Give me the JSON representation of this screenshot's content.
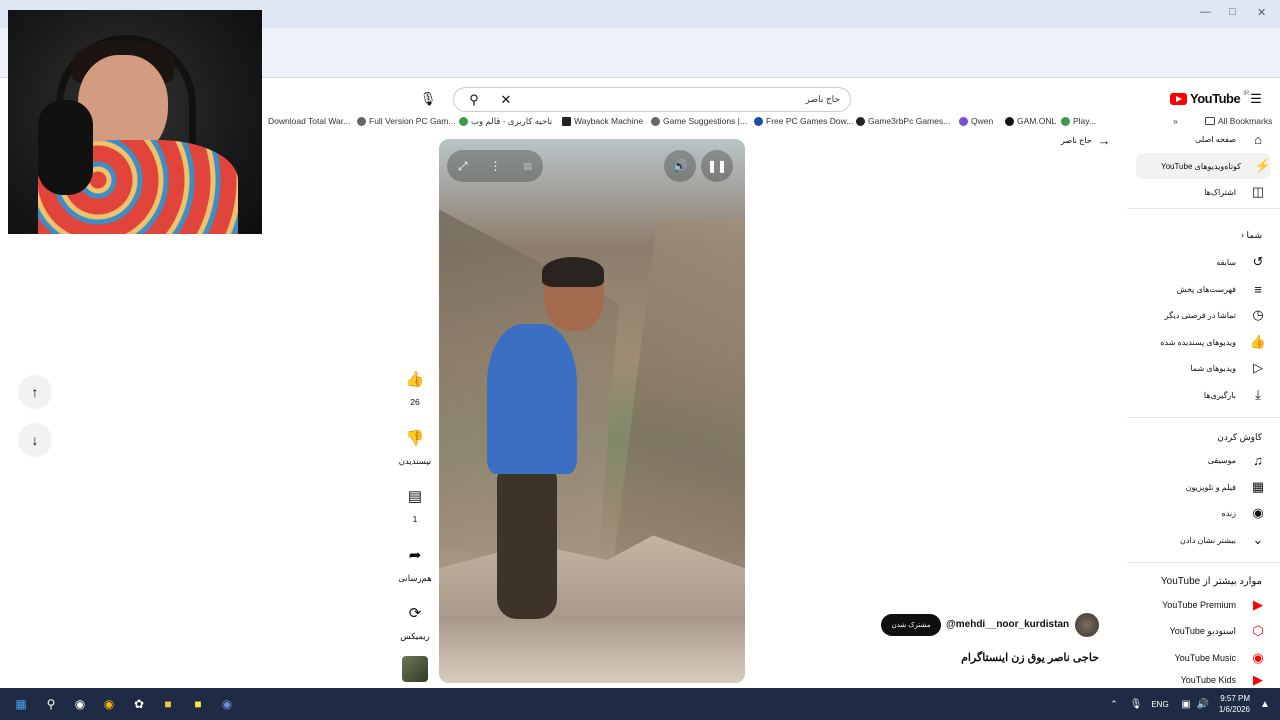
{
  "browser": {
    "bookmarks": [
      "Download Total War...",
      "Full Version PC Gam...",
      "ناحیه کاربری - قالم وب",
      "Wayback Machine",
      "Game Suggestions |...",
      "Free PC Games Dow...",
      "Game3rbPc Games...",
      "Qwen",
      "GAM.ONL",
      "Play..."
    ],
    "all_bookmarks": "All Bookmarks"
  },
  "youtube": {
    "logo_text": "YouTube",
    "logo_cc": "IR",
    "search": {
      "query": "حاج ناصر"
    },
    "back_label": "حاج ناصر",
    "sidebar": {
      "main": [
        {
          "label": "صفحه اصلی",
          "icon": "home-icon"
        },
        {
          "label": "کوتاه‌ویدیوهای YouTube",
          "icon": "shorts-icon"
        },
        {
          "label": "اشتراک‌ها",
          "icon": "subscriptions-icon"
        }
      ],
      "you_header": "شما",
      "you": [
        {
          "label": "سابقه",
          "icon": "history-icon"
        },
        {
          "label": "فهرست‌های پخش",
          "icon": "playlists-icon"
        },
        {
          "label": "تماشا در فرصتی دیگر",
          "icon": "watch-later-icon"
        },
        {
          "label": "ویدیوهای پسندیده شده",
          "icon": "liked-icon"
        },
        {
          "label": "ویدیوهای شما",
          "icon": "your-videos-icon"
        },
        {
          "label": "بارگیری‌ها",
          "icon": "downloads-icon"
        }
      ],
      "explore_header": "کاوش کردن",
      "explore": [
        {
          "label": "موسیقی",
          "icon": "music-icon"
        },
        {
          "label": "فیلم و تلویزیون",
          "icon": "film-icon"
        },
        {
          "label": "زنده",
          "icon": "live-icon"
        },
        {
          "label": "بیشتر نشان دادن",
          "icon": "chevron-down-icon"
        }
      ],
      "more_header": "موارد بیشتر از YouTube",
      "more": [
        {
          "label": "YouTube Premium"
        },
        {
          "label": "استودیو YouTube"
        },
        {
          "label": "YouTube Music"
        },
        {
          "label": "YouTube Kids"
        }
      ]
    },
    "actions": {
      "like_count": "26",
      "dislike_label": "نپسندیدن",
      "comment_count": "1",
      "share_label": "هم‌رسانی",
      "remix_label": "ریمیکس"
    },
    "channel": {
      "handle": "@mehdi__noor_kurdistan",
      "subscribe_label": "مشترک شدن"
    },
    "video_title": "حاجی ناصر یوق زن اینستاگرام"
  },
  "taskbar": {
    "time": "9:57 PM",
    "date": "1/6/2026",
    "lang": "ENG"
  },
  "colors": {
    "youtube_red": "#ff0000",
    "taskbar": "#1f2a44",
    "chrome_frame": "#dfe7f5"
  }
}
